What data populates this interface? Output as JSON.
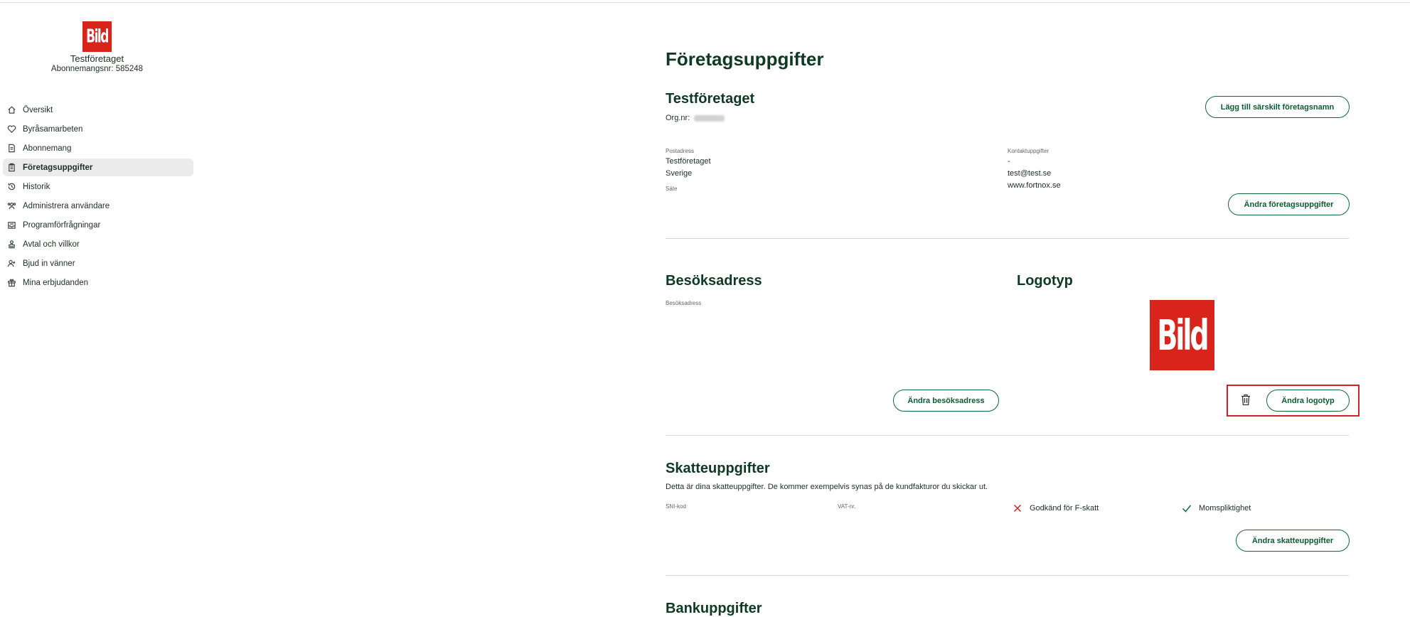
{
  "sidebar": {
    "logo_text": "Bild",
    "company_name": "Testföretaget",
    "subscription_nr": "Abonnemangsnr: 585248",
    "nav": [
      {
        "label": "Översikt",
        "icon": "home-icon"
      },
      {
        "label": "Byråsamarbeten",
        "icon": "heart-icon"
      },
      {
        "label": "Abonnemang",
        "icon": "document-icon"
      },
      {
        "label": "Företagsuppgifter",
        "icon": "clipboard-icon",
        "active": true
      },
      {
        "label": "Historik",
        "icon": "history-icon"
      },
      {
        "label": "Administrera användare",
        "icon": "users-icon"
      },
      {
        "label": "Programförfrågningar",
        "icon": "inbox-icon"
      },
      {
        "label": "Avtal och villkor",
        "icon": "stamp-icon"
      },
      {
        "label": "Bjud in vänner",
        "icon": "user-plus-icon"
      },
      {
        "label": "Mina erbjudanden",
        "icon": "gift-icon"
      }
    ]
  },
  "main": {
    "title": "Företagsuppgifter",
    "company": {
      "name": "Testföretaget",
      "org_label": "Org.nr:",
      "add_name_button": "Lägg till särskilt företagsnamn",
      "postal_label": "Postadress",
      "postal_lines": [
        "Testföretaget",
        "Sverige"
      ],
      "seat_label": "Säte",
      "contact_label": "Kontaktuppgifter",
      "contact_lines": [
        "-",
        "test@test.se",
        "www.fortnox.se"
      ],
      "edit_button": "Ändra företagsuppgifter"
    },
    "visit": {
      "title": "Besöksadress",
      "label": "Besöksadress",
      "edit_button": "Ändra besöksadress"
    },
    "logo": {
      "title": "Logotyp",
      "logo_text": "Bild",
      "edit_button": "Ändra logotyp"
    },
    "tax": {
      "title": "Skatteuppgifter",
      "description": "Detta är dina skatteuppgifter. De kommer exempelvis synas på de kundfakturor du skickar ut.",
      "sni_label": "SNI-kod",
      "vat_label": "VAT-nr.",
      "f_tax": "Godkänd för F-skatt",
      "vat_registered": "Momspliktighet",
      "edit_button": "Ändra skatteuppgifter"
    },
    "bank": {
      "title": "Bankuppgifter"
    }
  },
  "colors": {
    "brand_red": "#d9241c",
    "primary_green": "#0e6a3a",
    "heading": "#0e3a24",
    "highlight": "#d0202a"
  }
}
